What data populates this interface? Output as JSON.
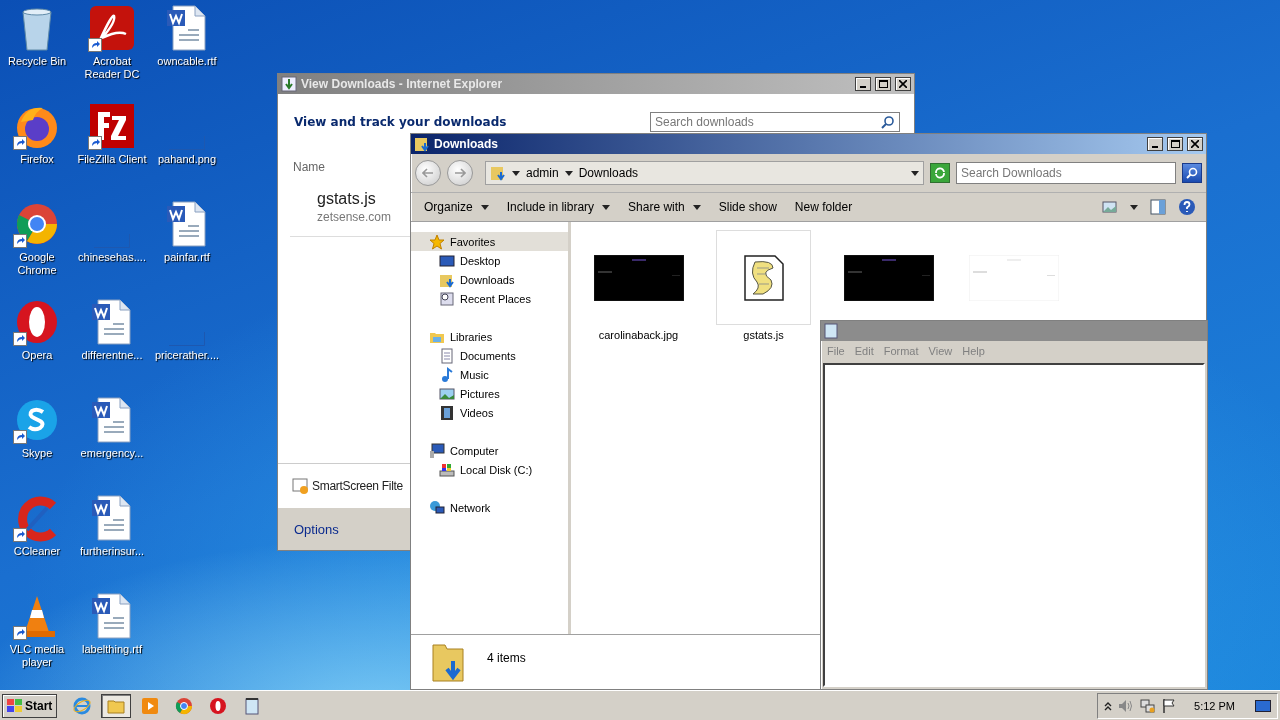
{
  "desktop": {
    "icons": [
      {
        "kind": "recycle-bin",
        "label": "Recycle Bin",
        "shortcut": false
      },
      {
        "kind": "firefox",
        "label": "Firefox",
        "shortcut": true
      },
      {
        "kind": "chrome",
        "label": "Google Chrome",
        "shortcut": true
      },
      {
        "kind": "opera",
        "label": "Opera",
        "shortcut": true
      },
      {
        "kind": "skype",
        "label": "Skype",
        "shortcut": true
      },
      {
        "kind": "ccleaner",
        "label": "CCleaner",
        "shortcut": true
      },
      {
        "kind": "vlc",
        "label": "VLC media player",
        "shortcut": true
      },
      {
        "kind": "acrobat",
        "label": "Acrobat Reader DC",
        "shortcut": true
      },
      {
        "kind": "filezilla",
        "label": "FileZilla Client",
        "shortcut": true
      },
      {
        "kind": "blank",
        "label": "chinesehas....",
        "shortcut": false
      },
      {
        "kind": "word",
        "label": "differentne...",
        "shortcut": false
      },
      {
        "kind": "word",
        "label": "emergency...",
        "shortcut": false
      },
      {
        "kind": "word",
        "label": "furtherinsur...",
        "shortcut": false
      },
      {
        "kind": "word",
        "label": "labelthing.rtf",
        "shortcut": false
      },
      {
        "kind": "word",
        "label": "owncable.rtf",
        "shortcut": false
      },
      {
        "kind": "blank",
        "label": "pahand.png",
        "shortcut": false
      },
      {
        "kind": "word",
        "label": "painfar.rtf",
        "shortcut": false
      },
      {
        "kind": "blank",
        "label": "pricerather....",
        "shortcut": false
      }
    ]
  },
  "ie_window": {
    "title": "View Downloads - Internet Explorer",
    "heading": "View and track your downloads",
    "search": {
      "placeholder": "Search downloads"
    },
    "column": "Name",
    "downloads": [
      {
        "name": "gstats.js",
        "source": "zetsense.com"
      }
    ],
    "smartscreen": "SmartScreen Filte",
    "footer_link": "Options"
  },
  "explorer": {
    "title": "Downloads",
    "breadcrumb": [
      "admin",
      "Downloads"
    ],
    "search": {
      "placeholder": "Search Downloads"
    },
    "toolbar": [
      {
        "label": "Organize",
        "menu": true
      },
      {
        "label": "Include in library",
        "menu": true
      },
      {
        "label": "Share with",
        "menu": true
      },
      {
        "label": "Slide show",
        "menu": false
      },
      {
        "label": "New folder",
        "menu": false
      }
    ],
    "nav": [
      {
        "kind": "star",
        "label": "Favorites",
        "selected": true,
        "children": [
          {
            "kind": "desktop",
            "label": "Desktop",
            "selected": false
          },
          {
            "kind": "downloads",
            "label": "Downloads",
            "selected": false
          },
          {
            "kind": "recent",
            "label": "Recent Places",
            "selected": false
          }
        ]
      },
      {
        "kind": "libraries",
        "label": "Libraries",
        "selected": false,
        "children": [
          {
            "kind": "documents",
            "label": "Documents",
            "selected": false
          },
          {
            "kind": "music",
            "label": "Music",
            "selected": false
          },
          {
            "kind": "pictures",
            "label": "Pictures",
            "selected": false
          },
          {
            "kind": "videos",
            "label": "Videos",
            "selected": false
          }
        ]
      },
      {
        "kind": "computer",
        "label": "Computer",
        "selected": false,
        "children": [
          {
            "kind": "disk",
            "label": "Local Disk (C:)",
            "selected": false
          }
        ]
      },
      {
        "kind": "network",
        "label": "Network",
        "selected": false
      }
    ],
    "items": [
      {
        "kind": "dark-image",
        "label": "carolinaback.jpg"
      },
      {
        "kind": "script",
        "label": "gstats.js"
      },
      {
        "kind": "dark-image"
      },
      {
        "kind": "light-image"
      }
    ],
    "status": "4 items"
  },
  "notepad": {
    "menu": [
      "File",
      "Edit",
      "Format",
      "View",
      "Help"
    ]
  },
  "taskbar": {
    "start": "Start",
    "apps": [
      {
        "kind": "ie",
        "selected": false
      },
      {
        "kind": "explorer",
        "selected": true
      },
      {
        "kind": "media",
        "selected": false
      },
      {
        "kind": "chrome",
        "selected": false
      },
      {
        "kind": "opera",
        "selected": false
      },
      {
        "kind": "notepad",
        "selected": false
      }
    ],
    "clock": "5:12 PM"
  }
}
